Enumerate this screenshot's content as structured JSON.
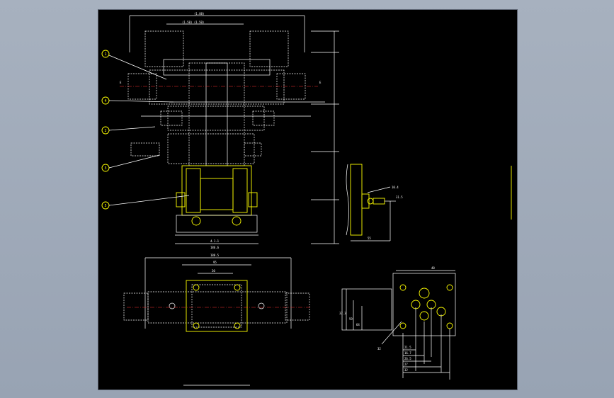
{
  "viewer": {
    "background": "#a0aab9",
    "paper": "#000000"
  },
  "colors": {
    "outline": "#ffffff",
    "highlight": "#ffff00",
    "centerline": "#ff3030"
  },
  "balloons": [
    "1",
    "4",
    "2",
    "3",
    "5"
  ],
  "dims": {
    "top_overall": "(1.88)",
    "top_sub": "(1.50) (1.50)",
    "section_left": "E",
    "section_right": "E",
    "width_plate": "186.6",
    "bottom_dim": "4.1.1",
    "port_mark": "10.4",
    "port_mark2": "31.5",
    "side_width": "55",
    "plan_overall": "188.5",
    "plan_inner": "95",
    "plan_small": "20",
    "right_top": "48",
    "right_side": "32",
    "right_labels": [
      "21.5",
      "16.7",
      "26.5",
      "27",
      "32",
      "37.3",
      "59",
      "64"
    ]
  }
}
